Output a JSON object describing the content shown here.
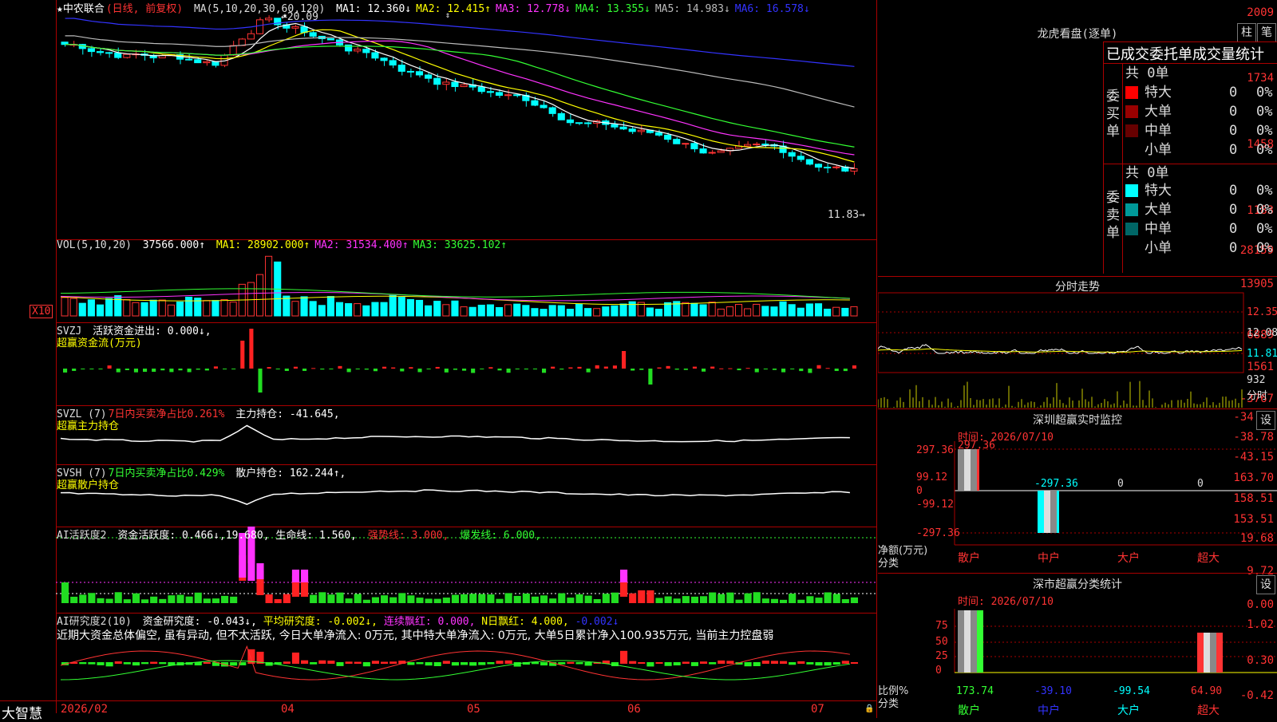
{
  "app": {
    "brand": "大智慧"
  },
  "main_chart": {
    "stock_title": "★中农联合",
    "period_label": "(日线, 前复权)",
    "ma_params": "MA(5,10,20,30,60,120)",
    "ma_values": [
      {
        "label": "MA1: 12.360↓",
        "color": "#ffffff"
      },
      {
        "label": "MA2: 12.415↑",
        "color": "#ffff00"
      },
      {
        "label": "MA3: 12.778↓",
        "color": "#ff33ff"
      },
      {
        "label": "MA4: 13.355↓",
        "color": "#33ff33"
      },
      {
        "label": "MA5: 14.983↓",
        "color": "#bbbbbb"
      },
      {
        "label": "MA6: 16.578↓",
        "color": "#3333ff"
      }
    ],
    "high_annotation": "20.09",
    "low_annotation": "11.83",
    "y_ticks": [
      "2009",
      "1734",
      "1458",
      "1183"
    ],
    "x_ticks": [
      "2026/02",
      "04",
      "05",
      "06",
      "07"
    ]
  },
  "volume_panel": {
    "header": "VOL(5,10,20)",
    "value": "37566.000↑",
    "ma_values": [
      {
        "label": "MA1: 28902.000↑",
        "color": "#ffff00"
      },
      {
        "label": "MA2: 31534.400↑",
        "color": "#ff33ff"
      },
      {
        "label": "MA3: 33625.102↑",
        "color": "#33ff33"
      }
    ],
    "y_ticks": [
      "28159",
      "13905"
    ],
    "multiplier": "X10"
  },
  "svzj_panel": {
    "header": "SVZJ",
    "line1": "活跃资金进出: 0.000↓,",
    "line2": "超赢资金流(万元)",
    "y_ticks": [
      "6889",
      "1561",
      "-3767"
    ]
  },
  "svzl_panel": {
    "header": "SVZL (7)",
    "info": "7日内买卖净占比0.261%",
    "main": "主力持仓: -41.645,",
    "line2": "超赢主力持仓",
    "y_ticks": [
      "-34.41",
      "-38.78",
      "-43.15"
    ]
  },
  "svsh_panel": {
    "header": "SVSH (7)",
    "info": "7日内买卖净占比0.429%",
    "main": "散户持仓: 162.244↑,",
    "line2": "超赢散户持仓",
    "y_ticks": [
      "163.70",
      "158.51",
      "153.51"
    ]
  },
  "ai_active_panel": {
    "header": "AI活跃度2",
    "item1": "资金活跃度: 0.466↓,19.680,",
    "item2": "生命线: 1.560,",
    "item3": "强势线: 3.000,",
    "item4": "爆发线: 6.000,",
    "y_ticks": [
      "19.68",
      "9.72",
      "0.00"
    ]
  },
  "ai_research_panel": {
    "header": "AI研究度2(10)",
    "item1": "资金研究度: -0.043↓,",
    "item2": "平均研究度: -0.002↓,",
    "item3": "连续飘红: 0.000,",
    "item4": "N日飘红: 4.000,",
    "item5": "-0.002↓",
    "comment": "近期大资金总体偏空, 虽有异动, 但不太活跃, 今日大单净流入: 0万元, 其中特大单净流入: 0万元, 大单5日累计净入100.935万元, 当前主力控盘弱",
    "y_ticks": [
      "1.02",
      "0.30",
      "-0.42"
    ]
  },
  "longhu": {
    "title": "龙虎看盘(逐单)",
    "btn_bar": "柱",
    "btn_pen": "笔",
    "subtitle": "已成交委托单成交量统计",
    "buy_label": "委买单",
    "sell_label": "委卖单",
    "buy_total": "共 0单",
    "sell_total": "共 0单",
    "buy_rows": [
      {
        "name": "特大",
        "value": "0",
        "pct": "0%",
        "color": "#ff0000"
      },
      {
        "name": "大单",
        "value": "0",
        "pct": "0%",
        "color": "#990000"
      },
      {
        "name": "中单",
        "value": "0",
        "pct": "0%",
        "color": "#660000"
      },
      {
        "name": "小单",
        "value": "0",
        "pct": "0%",
        "color": ""
      }
    ],
    "sell_rows": [
      {
        "name": "特大",
        "value": "0",
        "pct": "0%",
        "color": "#00ffff"
      },
      {
        "name": "大单",
        "value": "0",
        "pct": "0%",
        "color": "#009999"
      },
      {
        "name": "中单",
        "value": "0",
        "pct": "0%",
        "color": "#006666"
      },
      {
        "name": "小单",
        "value": "0",
        "pct": "0%",
        "color": ""
      }
    ]
  },
  "intraday": {
    "title": "分时走势",
    "y_ticks": [
      "12.35",
      "12.08",
      "11.81"
    ],
    "vol_tick": "932",
    "vol_label": "分时"
  },
  "sz_monitor": {
    "title": "深圳超赢实时监控",
    "btn": "设",
    "time": "时间: 2026/07/10",
    "y_ticks": [
      "297.36",
      "99.12",
      "0",
      "-99.12",
      "-297.36"
    ],
    "bar_labels": [
      "297.36",
      "-297.36",
      "0",
      "0"
    ],
    "axis_label": "净额(万元)",
    "axis_label2": "分类",
    "categories": [
      "散户",
      "中户",
      "大户",
      "超大"
    ]
  },
  "sz_stats": {
    "title": "深市超赢分类统计",
    "btn": "设",
    "time": "时间: 2026/07/10",
    "y_ticks": [
      "75",
      "50",
      "25",
      "0"
    ],
    "values": [
      "173.74",
      "-39.10",
      "-99.54",
      "64.90"
    ],
    "axis_label": "比例%",
    "axis_label2": "分类",
    "categories": [
      "散户",
      "中户",
      "大户",
      "超大"
    ]
  }
}
